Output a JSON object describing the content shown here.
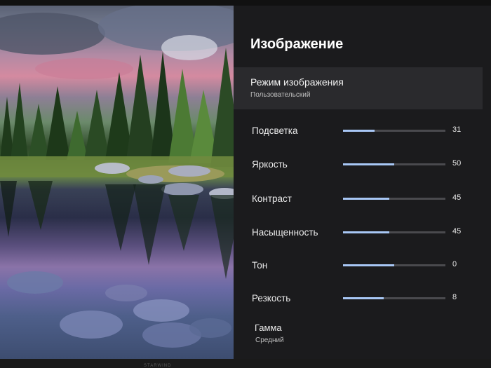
{
  "menu": {
    "title": "Изображение",
    "picture_mode": {
      "label": "Режим изображения",
      "value": "Пользовательский"
    },
    "settings": [
      {
        "label": "Подсветка",
        "value": "31",
        "level": 0.31
      },
      {
        "label": "Яркость",
        "value": "50",
        "level": 0.5
      },
      {
        "label": "Контраст",
        "value": "45",
        "level": 0.45
      },
      {
        "label": "Насыщенность",
        "value": "45",
        "level": 0.45
      },
      {
        "label": "Тон",
        "value": "0",
        "level": 0.5
      },
      {
        "label": "Резкость",
        "value": "8",
        "level": 0.4
      }
    ],
    "gamma": {
      "label": "Гамма",
      "value": "Средний"
    }
  },
  "colors": {
    "panel_bg": "#1b1b1d",
    "highlight_bg": "#2a2a2d",
    "slider_fill": "#a8c7f5",
    "slider_track": "#4a4a4e"
  },
  "bezel": {
    "brand": "STARWIND"
  }
}
